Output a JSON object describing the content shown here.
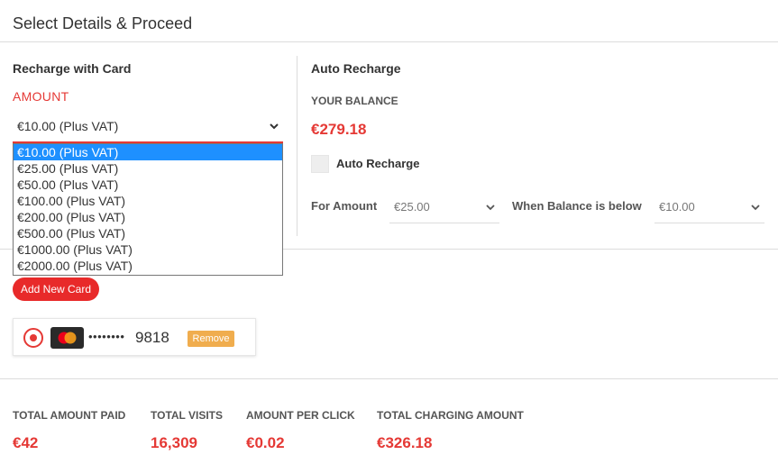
{
  "header": {
    "title": "Select Details & Proceed"
  },
  "recharge_card": {
    "title": "Recharge with Card",
    "amount_label": "AMOUNT",
    "selected_amount": "€10.00 (Plus VAT)",
    "options": [
      "€10.00 (Plus VAT)",
      "€25.00 (Plus VAT)",
      "€50.00 (Plus VAT)",
      "€100.00 (Plus VAT)",
      "€200.00 (Plus VAT)",
      "€500.00 (Plus VAT)",
      "€1000.00 (Plus VAT)",
      "€2000.00 (Plus VAT)"
    ],
    "add_card_label": "Add New Card",
    "saved_card": {
      "masked": "••••••••",
      "last4": "9818",
      "remove_label": "Remove",
      "brand_icon": "mastercard-icon"
    }
  },
  "auto_recharge": {
    "title": "Auto Recharge",
    "balance_label": "YOUR BALANCE",
    "balance_value": "€279.18",
    "checkbox_label": "Auto Recharge",
    "for_amount_label": "For Amount",
    "for_amount_value": "€25.00",
    "balance_below_label": "When Balance is below",
    "balance_below_value": "€10.00"
  },
  "stats": [
    {
      "label": "TOTAL AMOUNT PAID",
      "value": "€42"
    },
    {
      "label": "TOTAL VISITS",
      "value": "16,309"
    },
    {
      "label": "AMOUNT PER CLICK",
      "value": "€0.02"
    },
    {
      "label": "TOTAL CHARGING AMOUNT",
      "value": "€326.18"
    }
  ],
  "colors": {
    "accent": "#e53935",
    "selected_option": "#1e90ff",
    "remove_button": "#f0ad4e"
  }
}
